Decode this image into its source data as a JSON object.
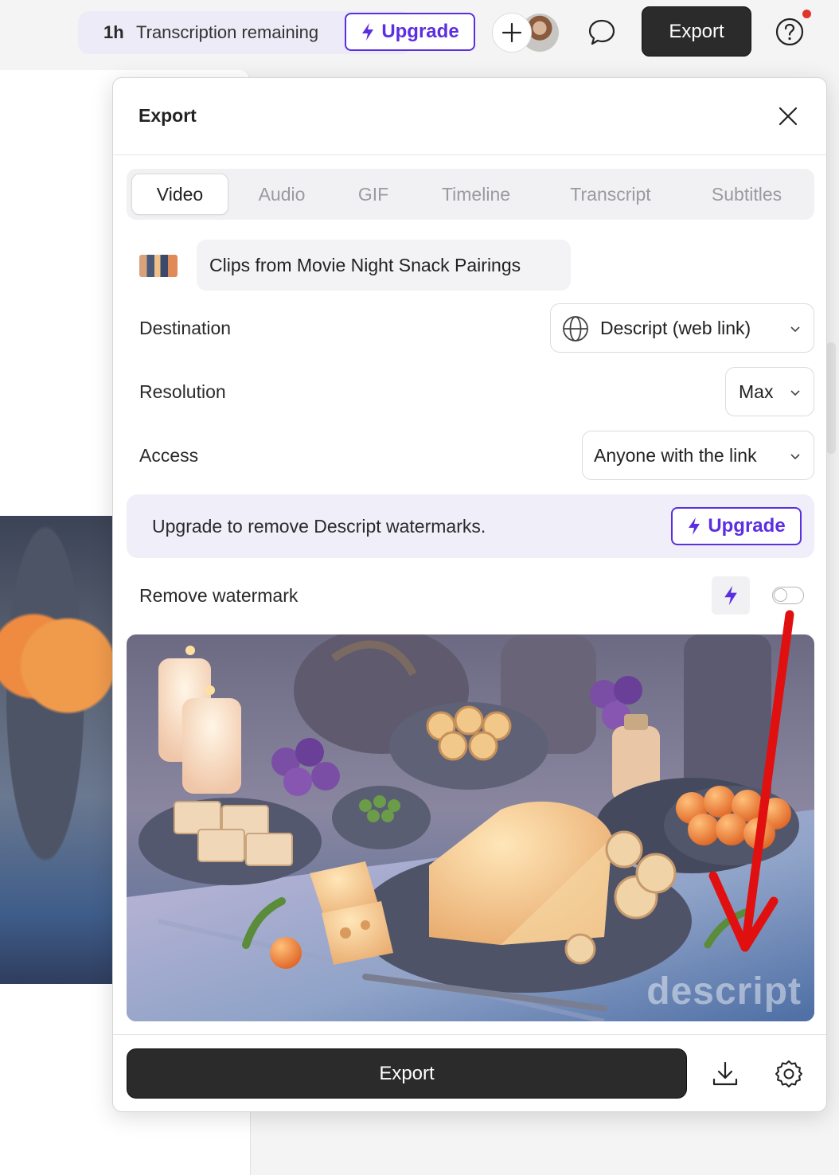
{
  "topbar": {
    "transcription_hours": "1h",
    "transcription_label": "Transcription remaining",
    "upgrade_label": "Upgrade",
    "export_label": "Export",
    "icons": [
      "plus-icon",
      "avatar",
      "comment-icon",
      "help-icon"
    ],
    "notification_color": "#e0352b"
  },
  "export_panel": {
    "title": "Export",
    "tabs": [
      {
        "label": "Video",
        "active": true
      },
      {
        "label": "Audio",
        "active": false
      },
      {
        "label": "GIF",
        "active": false
      },
      {
        "label": "Timeline",
        "active": false
      },
      {
        "label": "Transcript",
        "active": false
      },
      {
        "label": "Subtitles",
        "active": false
      }
    ],
    "file_title": "Clips from Movie Night Snack Pairings",
    "destination": {
      "label": "Destination",
      "value": "Descript (web link)",
      "icon": "globe-icon"
    },
    "resolution": {
      "label": "Resolution",
      "value": "Max"
    },
    "access": {
      "label": "Access",
      "value": "Anyone with the link"
    },
    "upsell": {
      "text": "Upgrade to remove Descript watermarks.",
      "button": "Upgrade"
    },
    "remove_watermark": {
      "label": "Remove watermark",
      "enabled": false
    },
    "preview_watermark": "descript",
    "export_button": "Export",
    "accent_color": "#5b2ee0"
  }
}
